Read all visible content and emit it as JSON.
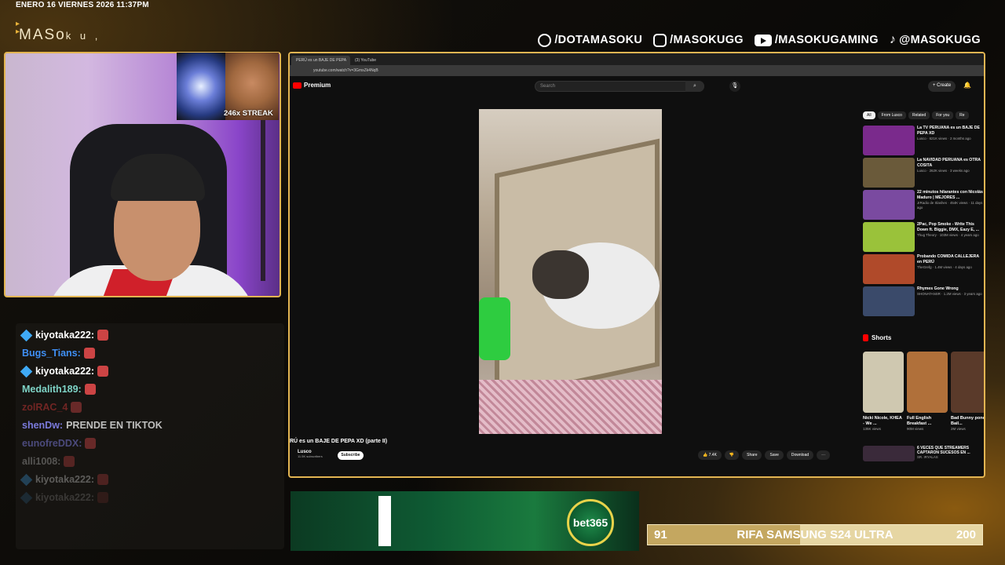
{
  "overlay": {
    "datetime": "ENERO 16 VIERNES 2026 11:37PM",
    "brand_main": "MASo",
    "brand_sub": "k u  ,",
    "streak": "246x STREAK",
    "socials": [
      {
        "icon": "facebook-icon",
        "label": "/DOTAMASOKU"
      },
      {
        "icon": "instagram-icon",
        "label": "/MASOKUGG"
      },
      {
        "icon": "youtube-icon",
        "label": "/MASOKUGAMING"
      },
      {
        "icon": "tiktok-icon",
        "label": "@MASOKUGG"
      }
    ],
    "ad_brand": "bet365",
    "raffle": {
      "left": "91",
      "title": "RIFA SAMSUNG S24 ULTRA",
      "right": "200",
      "progress": 0.455
    }
  },
  "chat": [
    {
      "user": "kiyotaka222:",
      "color": "#ffffff",
      "text": "",
      "badge": true,
      "opacity": 1
    },
    {
      "user": "Bugs_Tians:",
      "color": "#3f8ff5",
      "text": "",
      "badge": false,
      "opacity": 1
    },
    {
      "user": "kiyotaka222:",
      "color": "#ffffff",
      "text": "",
      "badge": true,
      "opacity": 1
    },
    {
      "user": "Medalith189:",
      "color": "#7ed3c6",
      "text": "",
      "badge": false,
      "opacity": 1
    },
    {
      "user": "zolRAC_4",
      "color": "#e03a3a",
      "text": "",
      "badge": false,
      "opacity": 0.45
    },
    {
      "user": "shenDw:",
      "color": "#8c8cff",
      "text": "PRENDE EN TIKTOK",
      "badge": false,
      "opacity": 0.85
    },
    {
      "user": "eunofreDDX:",
      "color": "#8c8cff",
      "text": "",
      "badge": false,
      "opacity": 0.45
    },
    {
      "user": "alli1008:",
      "color": "#cccccc",
      "text": "",
      "badge": false,
      "opacity": 0.35
    },
    {
      "user": "kiyotaka222:",
      "color": "#ffffff",
      "text": "",
      "badge": true,
      "opacity": 0.3
    },
    {
      "user": "kiyotaka222:",
      "color": "#ffffff",
      "text": "",
      "badge": true,
      "opacity": 0.15
    }
  ],
  "browser": {
    "tabs": [
      "PERÚ es un BAJE DE PEPA",
      "(3) YouTube"
    ],
    "url": "youtube.com/watch?v=3GmxZk4NqB",
    "yt_logo": "Premium",
    "search_placeholder": "Search",
    "create": "+ Create",
    "video_title": "RÚ es un BAJE DE PEPA XD (parte II)",
    "channel": "Lusco",
    "channel_subs": "11.5K subscribers",
    "subscribe": "Subscribe",
    "actions": [
      "👍 7.4K",
      "👎",
      "Share",
      "Save",
      "Download",
      "⋯"
    ],
    "chips": [
      "All",
      "From Lusco",
      "Related",
      "For you",
      "Re"
    ],
    "sidebar": [
      {
        "title": "La TV PERUANA es un BAJE DE PEPA XD",
        "meta": "Lusco · 621K views · 2 months ago",
        "color": "#7a2a8c"
      },
      {
        "title": "La NAVIDAD PERUANA es OTRA COSITA",
        "meta": "Lusco · 262K views · 3 weeks ago",
        "color": "#6a5a3a"
      },
      {
        "title": "22 minutos hilarantes con Nicolás Maduro | MEJORES ...",
        "meta": "JrRadio de Slashes · 454K views · 11 days ago",
        "color": "#7a4aa0"
      },
      {
        "title": "2Pac, Pop Smoke - Write This Down ft. Biggie, DMX, Eazy E, ...",
        "meta": "Thug Theory · 103M views · 4 years ago",
        "color": "#9ac23a"
      },
      {
        "title": "Probando COMIDA CALLEJERA en PERÚ",
        "meta": "TheGrefg · 1.4M views · 4 days ago",
        "color": "#b04a2a"
      },
      {
        "title": "Rhymes Gone Wrong",
        "meta": "SHONATANSR · 1.2M views · 3 years ago",
        "color": "#3a4a6a"
      }
    ],
    "shorts_label": "Shorts",
    "shorts": [
      {
        "title": "Nicki Nicole, KHEA - We ...",
        "views": "135K views",
        "color": "#cfc8b0"
      },
      {
        "title": "Full English Breakfast ...",
        "views": "90M views",
        "color": "#b0703a"
      },
      {
        "title": "Bad Bunny pone a Bail...",
        "views": "2M views",
        "color": "#5a3a2a"
      }
    ],
    "last_item": {
      "title": "6 VECES QUE STREAMERS CAPTARON SUCESOS EN ...",
      "meta": "SR. IRYALAS"
    }
  }
}
